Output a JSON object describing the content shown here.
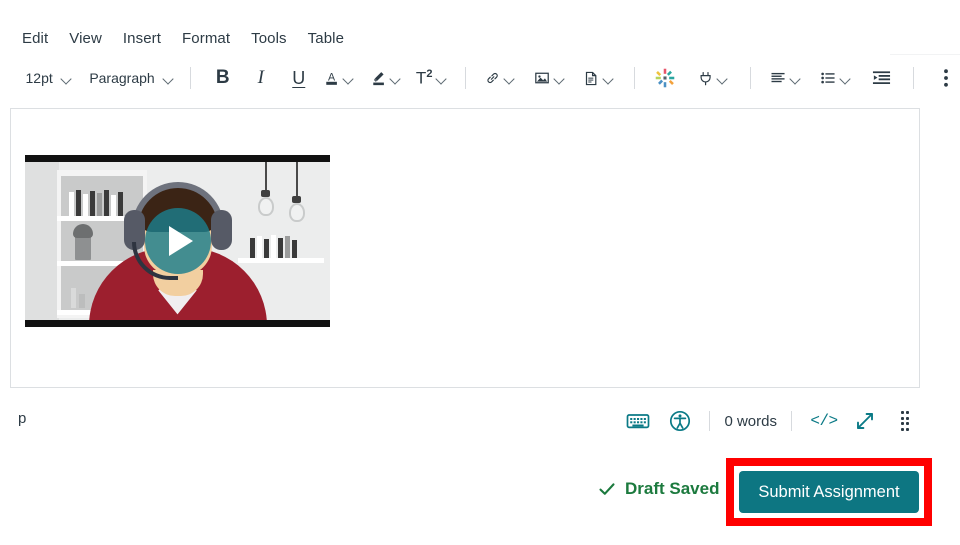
{
  "menubar": {
    "items": [
      {
        "label": "Edit",
        "name": "menu-edit"
      },
      {
        "label": "View",
        "name": "menu-view"
      },
      {
        "label": "Insert",
        "name": "menu-insert"
      },
      {
        "label": "Format",
        "name": "menu-format"
      },
      {
        "label": "Tools",
        "name": "menu-tools"
      },
      {
        "label": "Table",
        "name": "menu-table"
      }
    ]
  },
  "toolbar": {
    "font_size": "12pt",
    "block_format": "Paragraph",
    "bold_glyph": "B",
    "italic_glyph": "I",
    "underline_glyph": "U",
    "text_color_glyph": "A",
    "superscript_glyph": "T",
    "superscript_exponent": "2",
    "icons": {
      "link": "link-icon",
      "image": "image-icon",
      "document": "document-icon",
      "apps": "apps-sparkle-icon",
      "plug": "plug-icon",
      "align": "align-left-icon",
      "list": "bulleted-list-icon",
      "indent": "indent-increase-icon",
      "more": "more-options-kebab-icon",
      "highlighter": "text-highlight-icon"
    }
  },
  "editor": {
    "video": {
      "play_label": "play-video",
      "alt": "Student wearing headphones in a red hoodie, bookshelf background"
    }
  },
  "statusbar": {
    "element_path": "p",
    "word_count": "0 words",
    "html_editor_glyph": "</>",
    "icons": {
      "keyboard": "keyboard-shortcuts-icon",
      "accessibility": "accessibility-checker-icon",
      "html": "html-editor-icon",
      "fullscreen": "fullscreen-expand-icon",
      "resize": "resize-handle-icon"
    }
  },
  "footer": {
    "draft_status": "Draft Saved",
    "submit_label": "Submit Assignment"
  },
  "colors": {
    "accent_teal": "#0d7682",
    "draft_green": "#1c7a3e",
    "highlight_red": "#ff0000",
    "text_dark": "#2d3b45",
    "play_overlay": "#1c7e8c",
    "hoodie_red": "#9c1f2e"
  }
}
